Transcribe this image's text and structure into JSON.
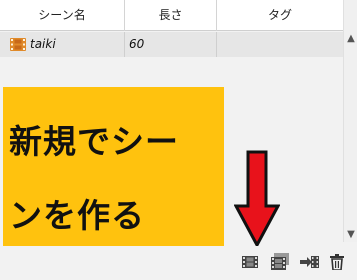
{
  "table": {
    "columns": [
      "シーン名",
      "長さ",
      "タグ"
    ],
    "rows": [
      {
        "name": "taiki",
        "length": "60",
        "tag": ""
      }
    ]
  },
  "annotation": {
    "line1": "新規でシー",
    "line2": "ンを作る",
    "background": "#ffc20e"
  },
  "arrow_color": "#e8121b",
  "toolbar": {
    "buttons": [
      "new-scene-icon",
      "duplicate-scene-icon",
      "import-scene-icon",
      "trash-icon"
    ]
  }
}
